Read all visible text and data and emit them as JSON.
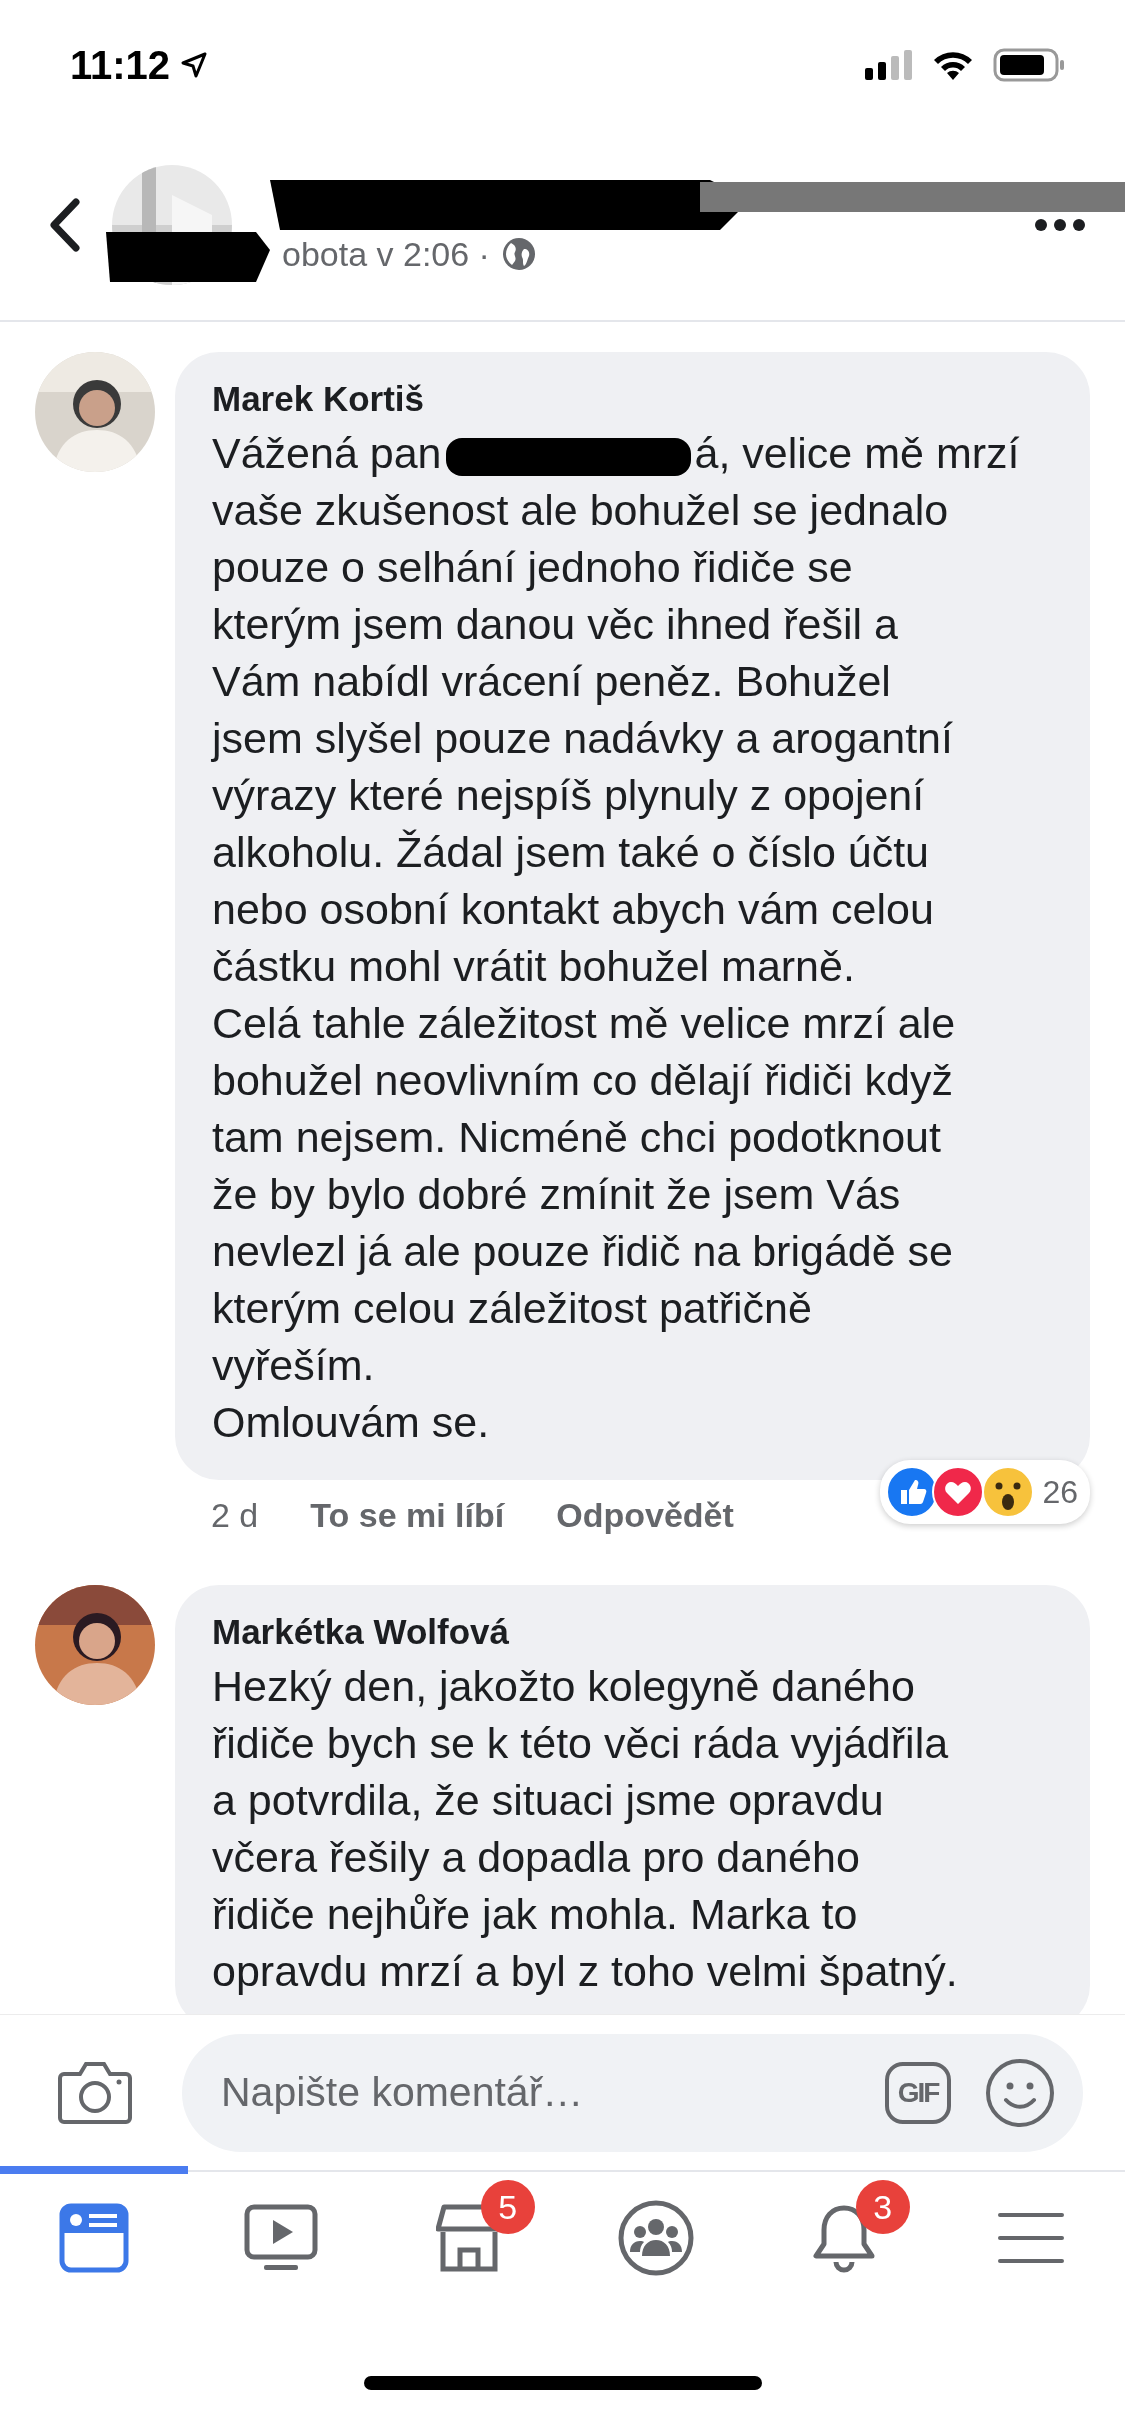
{
  "status_bar": {
    "time": "11:12"
  },
  "header": {
    "timestamp": "obota v 2:06 ·"
  },
  "comments": [
    {
      "author": "Marek Kortiš",
      "before_redaction": "Vážená pan",
      "body": "á, velice mě mrzí\nvaše zkušenost ale bohužel se jednalo\npouze o selhání jednoho řidiče se\nkterým jsem danou věc ihned řešil a\nVám nabídl vrácení peněz. Bohužel\njsem slyšel pouze nadávky a arogantní\nvýrazy které nejspíš plynuly z opojení\nalkoholu. Žádal jsem také o číslo účtu\nnebo osobní kontakt abych vám celou\nčástku mohl vrátit bohužel marně.\nCelá tahle záležitost mě velice mrzí ale\nbohužel neovlivním co dělají řidiči když\ntam nejsem. Nicméně chci podotknout\nže by bylo dobré zmínit že jsem Vás\nnevlezl já ale pouze řidič na brigádě se\nkterým celou záležitost patřičně\nvyřeším.\nOmlouvám se.",
      "time": "2 d",
      "actions": [
        "To se mi líbí",
        "Odpovědět"
      ],
      "reaction_count": "26"
    },
    {
      "author": "Markétka Wolfová",
      "body": "Hezký den, jakožto kolegyně daného\nřidiče bych se k této věci ráda vyjádřila\na potvrdila, že situaci jsme opravdu\nvčera řešily a dopadla pro daného\nřidiče nejhůře jak mohla. Marka to\nopravdu mrzí a byl z toho velmi špatný."
    }
  ],
  "composer": {
    "placeholder": "Napište komentář…",
    "gif_label": "GIF"
  },
  "tabs": [
    {
      "kind": "feed",
      "selected": true
    },
    {
      "kind": "video",
      "selected": false
    },
    {
      "kind": "marketplace",
      "selected": false,
      "badge": "5"
    },
    {
      "kind": "groups",
      "selected": false
    },
    {
      "kind": "notifications",
      "selected": false,
      "badge": "3"
    },
    {
      "kind": "menu",
      "selected": false
    }
  ]
}
